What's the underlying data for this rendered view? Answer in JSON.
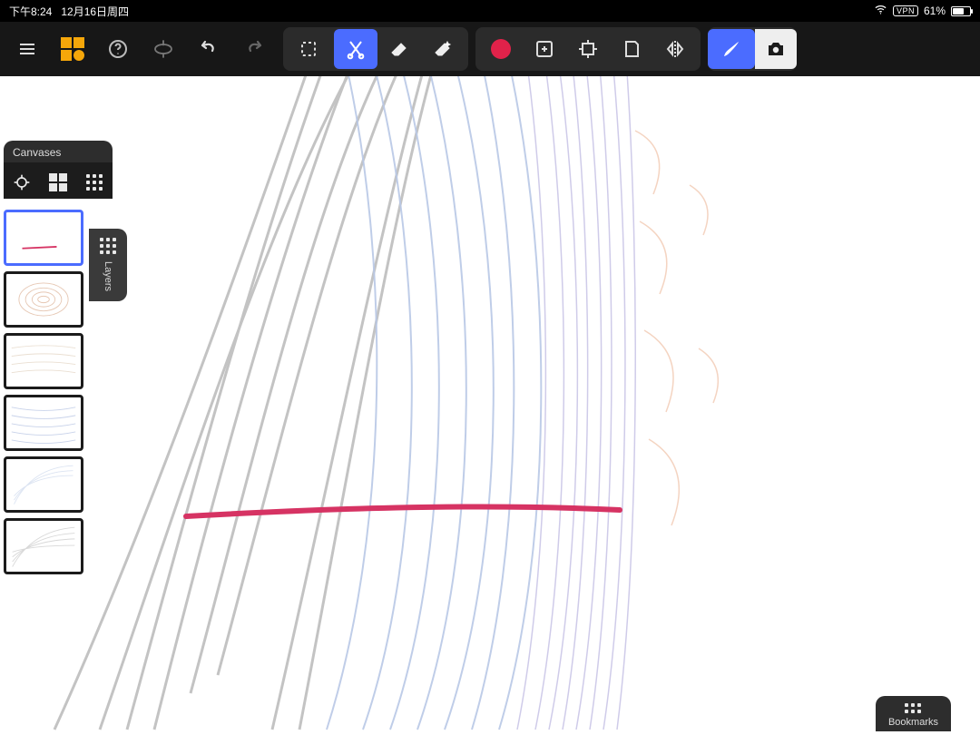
{
  "status": {
    "time": "下午8:24",
    "date": "12月16日周四",
    "vpn": "VPN",
    "battery_pct": "61%"
  },
  "toolbar": {
    "menu": "menu",
    "gallery": "gallery",
    "help": "help",
    "view": "view-3d",
    "undo": "undo",
    "redo": "redo",
    "select": "selection",
    "scissors": "cut-tool",
    "eraser": "eraser",
    "fill_eraser": "auto-eraser",
    "record": "record",
    "add_panel": "add-panel",
    "crop": "crop-align",
    "book": "flip-page",
    "mirror": "mirror",
    "brush": "brush",
    "camera": "camera"
  },
  "panels": {
    "canvases_title": "Canvases",
    "layers_title": "Layers",
    "bookmarks_title": "Bookmarks"
  },
  "thumbs": {
    "count": 6,
    "selected_index": 0
  },
  "colors": {
    "accent": "#4b6cff",
    "record": "#e1224a",
    "logo": "#f6a70a",
    "stroke_red": "#d63363"
  }
}
